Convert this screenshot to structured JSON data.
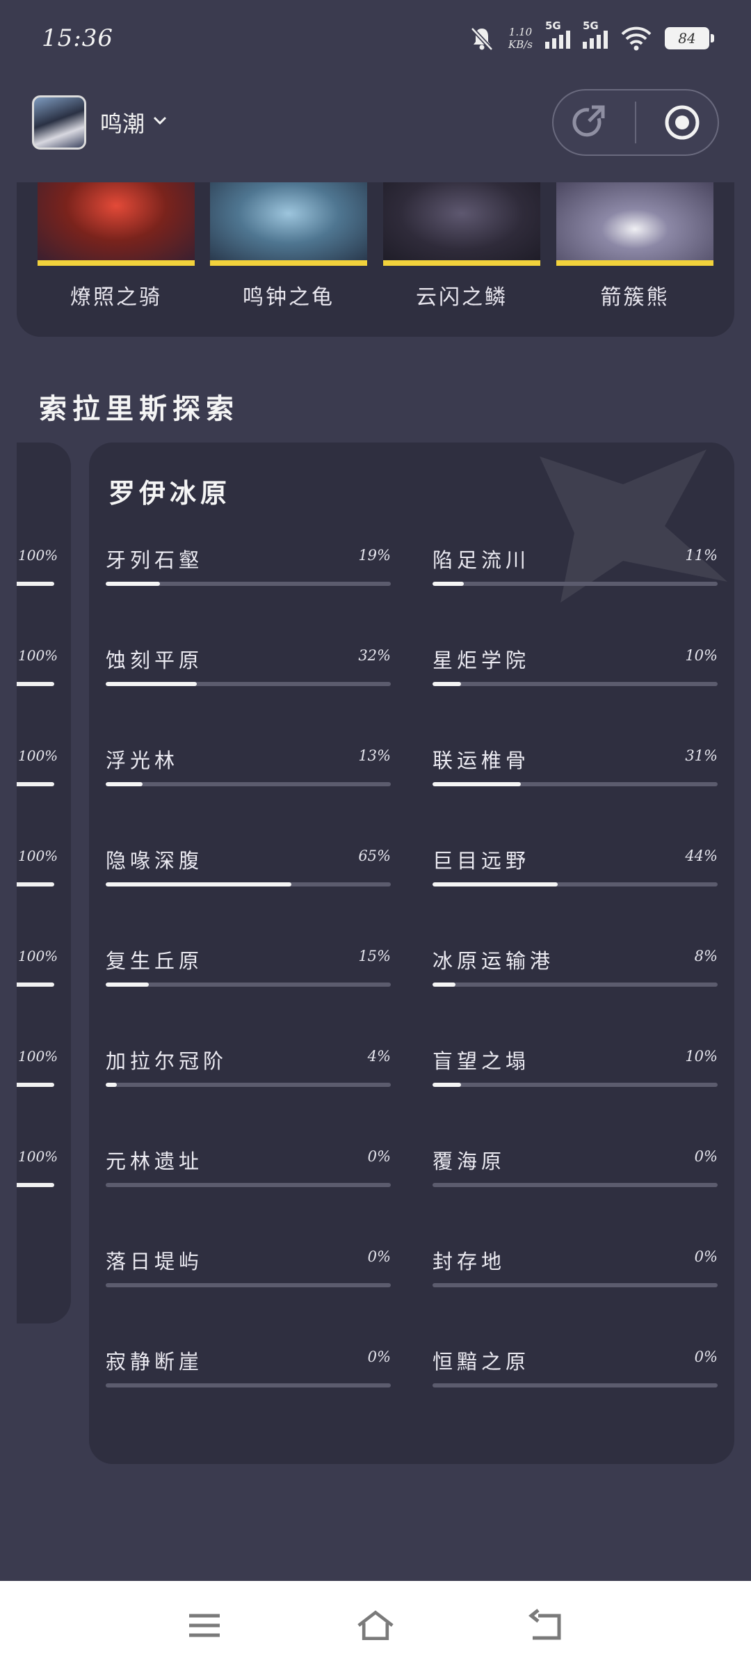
{
  "status_bar": {
    "time": "15:36",
    "net_speed_value": "1.10",
    "net_speed_unit": "KB/s",
    "signal1_label": "5G",
    "signal2_label": "5G",
    "battery": "84"
  },
  "header": {
    "app_name": "鸣潮",
    "share_icon": "share-icon",
    "record_icon": "record-icon"
  },
  "bosses": [
    {
      "name": "燎照之骑",
      "color": "#b53b2e"
    },
    {
      "name": "鸣钟之龟",
      "color": "#6b93ad"
    },
    {
      "name": "云闪之鳞",
      "color": "#4b4658"
    },
    {
      "name": "箭簇熊",
      "color": "#7f7b99"
    }
  ],
  "section_title": "索拉里斯探索",
  "previous_region_progress": [
    "100%",
    "100%",
    "100%",
    "100%",
    "100%",
    "100%",
    "100%"
  ],
  "region": {
    "title": "罗伊冰原",
    "areas": [
      {
        "name": "牙列石壑",
        "percent": "19%",
        "value": 19
      },
      {
        "name": "陷足流川",
        "percent": "11%",
        "value": 11
      },
      {
        "name": "蚀刻平原",
        "percent": "32%",
        "value": 32
      },
      {
        "name": "星炬学院",
        "percent": "10%",
        "value": 10
      },
      {
        "name": "浮光林",
        "percent": "13%",
        "value": 13
      },
      {
        "name": "联运椎骨",
        "percent": "31%",
        "value": 31
      },
      {
        "name": "隐喙深腹",
        "percent": "65%",
        "value": 65
      },
      {
        "name": "巨目远野",
        "percent": "44%",
        "value": 44
      },
      {
        "name": "复生丘原",
        "percent": "15%",
        "value": 15
      },
      {
        "name": "冰原运输港",
        "percent": "8%",
        "value": 8
      },
      {
        "name": "加拉尔冠阶",
        "percent": "4%",
        "value": 4
      },
      {
        "name": "盲望之塌",
        "percent": "10%",
        "value": 10
      },
      {
        "name": "元林遗址",
        "percent": "0%",
        "value": 0
      },
      {
        "name": "覆海原",
        "percent": "0%",
        "value": 0
      },
      {
        "name": "落日堤屿",
        "percent": "0%",
        "value": 0
      },
      {
        "name": "封存地",
        "percent": "0%",
        "value": 0
      },
      {
        "name": "寂静断崖",
        "percent": "0%",
        "value": 0
      },
      {
        "name": "恒黯之原",
        "percent": "0%",
        "value": 0
      }
    ]
  },
  "nav": {
    "menu_icon": "menu-icon",
    "home_icon": "home-icon",
    "back_icon": "back-icon"
  }
}
